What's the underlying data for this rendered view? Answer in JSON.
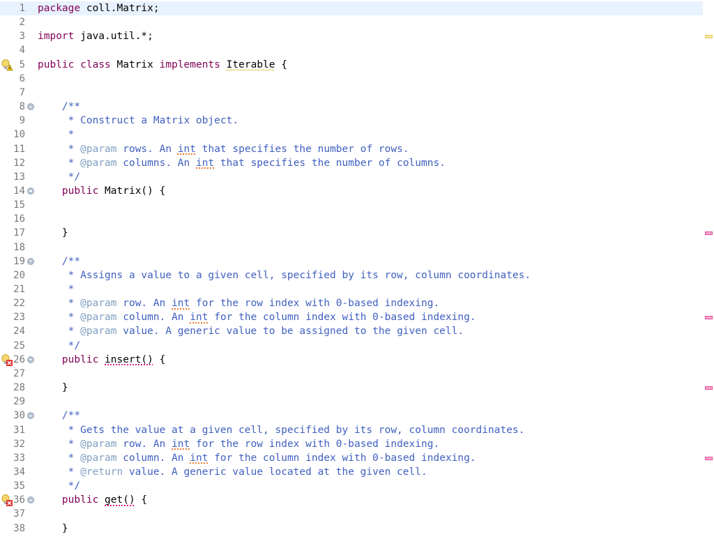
{
  "editor": {
    "language": "java",
    "current_line": 1,
    "lines": [
      {
        "n": "1",
        "tokens": [
          {
            "t": "package",
            "c": "kw"
          },
          {
            "t": " coll.Matrix;",
            "c": "tx"
          }
        ]
      },
      {
        "n": "2",
        "tokens": []
      },
      {
        "n": "3",
        "tokens": [
          {
            "t": "import",
            "c": "kw"
          },
          {
            "t": " java.util.*;",
            "c": "tx"
          }
        ]
      },
      {
        "n": "4",
        "tokens": []
      },
      {
        "n": "5",
        "marker": "warning",
        "tokens": [
          {
            "t": "public",
            "c": "kw"
          },
          {
            "t": " ",
            "c": "tx"
          },
          {
            "t": "class",
            "c": "kw"
          },
          {
            "t": " Matrix ",
            "c": "tx"
          },
          {
            "t": "implements",
            "c": "kw"
          },
          {
            "t": " ",
            "c": "tx"
          },
          {
            "t": "Iterable",
            "c": "tx warn-u"
          },
          {
            "t": " {",
            "c": "tx"
          }
        ]
      },
      {
        "n": "6",
        "tokens": []
      },
      {
        "n": "7",
        "tokens": []
      },
      {
        "n": "8",
        "fold": true,
        "tokens": [
          {
            "t": "    /**",
            "c": "jd"
          }
        ]
      },
      {
        "n": "9",
        "tokens": [
          {
            "t": "     * Construct a Matrix object.",
            "c": "jd"
          }
        ]
      },
      {
        "n": "10",
        "tokens": [
          {
            "t": "     *",
            "c": "jd"
          }
        ]
      },
      {
        "n": "11",
        "tokens": [
          {
            "t": "     * ",
            "c": "jd"
          },
          {
            "t": "@param",
            "c": "tag"
          },
          {
            "t": " rows. An ",
            "c": "jd"
          },
          {
            "t": "int",
            "c": "jd spell"
          },
          {
            "t": " that specifies the number of rows.",
            "c": "jd"
          }
        ]
      },
      {
        "n": "12",
        "tokens": [
          {
            "t": "     * ",
            "c": "jd"
          },
          {
            "t": "@param",
            "c": "tag"
          },
          {
            "t": " columns. An ",
            "c": "jd"
          },
          {
            "t": "int",
            "c": "jd spell"
          },
          {
            "t": " that specifies the number of columns.",
            "c": "jd"
          }
        ]
      },
      {
        "n": "13",
        "tokens": [
          {
            "t": "     */",
            "c": "jd"
          }
        ]
      },
      {
        "n": "14",
        "fold": true,
        "tokens": [
          {
            "t": "    ",
            "c": "tx"
          },
          {
            "t": "public",
            "c": "kw"
          },
          {
            "t": " Matrix() {",
            "c": "tx"
          }
        ]
      },
      {
        "n": "15",
        "tokens": []
      },
      {
        "n": "16",
        "tokens": []
      },
      {
        "n": "17",
        "tokens": [
          {
            "t": "    }",
            "c": "tx"
          }
        ]
      },
      {
        "n": "18",
        "tokens": []
      },
      {
        "n": "19",
        "fold": true,
        "tokens": [
          {
            "t": "    /**",
            "c": "jd"
          }
        ]
      },
      {
        "n": "20",
        "tokens": [
          {
            "t": "     * Assigns a value to a given cell, specified by its row, column coordinates.",
            "c": "jd"
          }
        ]
      },
      {
        "n": "21",
        "tokens": [
          {
            "t": "     *",
            "c": "jd"
          }
        ]
      },
      {
        "n": "22",
        "tokens": [
          {
            "t": "     * ",
            "c": "jd"
          },
          {
            "t": "@param",
            "c": "tag"
          },
          {
            "t": " row. An ",
            "c": "jd"
          },
          {
            "t": "int",
            "c": "jd spell"
          },
          {
            "t": " for the row index with 0-based indexing.",
            "c": "jd"
          }
        ]
      },
      {
        "n": "23",
        "tokens": [
          {
            "t": "     * ",
            "c": "jd"
          },
          {
            "t": "@param",
            "c": "tag"
          },
          {
            "t": " column. An ",
            "c": "jd"
          },
          {
            "t": "int",
            "c": "jd spell"
          },
          {
            "t": " for the column index with 0-based indexing.",
            "c": "jd"
          }
        ]
      },
      {
        "n": "24",
        "tokens": [
          {
            "t": "     * ",
            "c": "jd"
          },
          {
            "t": "@param",
            "c": "tag"
          },
          {
            "t": " value. A generic value to be assigned to the given cell.",
            "c": "jd"
          }
        ]
      },
      {
        "n": "25",
        "tokens": [
          {
            "t": "     */",
            "c": "jd"
          }
        ]
      },
      {
        "n": "26",
        "fold": true,
        "marker": "error",
        "tokens": [
          {
            "t": "    ",
            "c": "tx"
          },
          {
            "t": "public",
            "c": "kw"
          },
          {
            "t": " ",
            "c": "tx"
          },
          {
            "t": "insert()",
            "c": "tx err-u"
          },
          {
            "t": " {",
            "c": "tx"
          }
        ]
      },
      {
        "n": "27",
        "tokens": []
      },
      {
        "n": "28",
        "tokens": [
          {
            "t": "    }",
            "c": "tx"
          }
        ]
      },
      {
        "n": "29",
        "tokens": []
      },
      {
        "n": "30",
        "fold": true,
        "tokens": [
          {
            "t": "    /**",
            "c": "jd"
          }
        ]
      },
      {
        "n": "31",
        "tokens": [
          {
            "t": "     * Gets the value at a given cell, specified by its row, column coordinates.",
            "c": "jd"
          }
        ]
      },
      {
        "n": "32",
        "tokens": [
          {
            "t": "     * ",
            "c": "jd"
          },
          {
            "t": "@param",
            "c": "tag"
          },
          {
            "t": " row. An ",
            "c": "jd"
          },
          {
            "t": "int",
            "c": "jd spell"
          },
          {
            "t": " for the row index with 0-based indexing.",
            "c": "jd"
          }
        ]
      },
      {
        "n": "33",
        "tokens": [
          {
            "t": "     * ",
            "c": "jd"
          },
          {
            "t": "@param",
            "c": "tag"
          },
          {
            "t": " column. An ",
            "c": "jd"
          },
          {
            "t": "int",
            "c": "jd spell"
          },
          {
            "t": " for the column index with 0-based indexing.",
            "c": "jd"
          }
        ]
      },
      {
        "n": "34",
        "tokens": [
          {
            "t": "     * ",
            "c": "jd"
          },
          {
            "t": "@return",
            "c": "tag"
          },
          {
            "t": " value. A generic value located at the given cell.",
            "c": "jd"
          }
        ]
      },
      {
        "n": "35",
        "tokens": [
          {
            "t": "     */",
            "c": "jd"
          }
        ]
      },
      {
        "n": "36",
        "fold": true,
        "marker": "error",
        "tokens": [
          {
            "t": "    ",
            "c": "tx"
          },
          {
            "t": "public",
            "c": "kw"
          },
          {
            "t": " ",
            "c": "tx"
          },
          {
            "t": "get()",
            "c": "tx err-u"
          },
          {
            "t": " {",
            "c": "tx"
          }
        ]
      },
      {
        "n": "37",
        "tokens": []
      },
      {
        "n": "38",
        "tokens": [
          {
            "t": "    }",
            "c": "tx"
          }
        ]
      }
    ]
  },
  "overview_ruler": [
    {
      "type": "warning",
      "line": 3
    },
    {
      "type": "error",
      "line": 17
    },
    {
      "type": "error",
      "line": 23
    },
    {
      "type": "error",
      "line": 28
    },
    {
      "type": "error",
      "line": 33
    }
  ],
  "icons": {
    "warning_marker": "lightbulb-warning-icon",
    "error_marker": "lightbulb-error-icon",
    "fold": "fold-collapse-icon"
  },
  "colors": {
    "keyword": "#7f0055",
    "javadoc": "#3f5fbf",
    "javadoc_tag": "#7f9fbf",
    "current_line": "#e8f2fe",
    "error": "#e0218a",
    "warning": "#d6b300"
  }
}
